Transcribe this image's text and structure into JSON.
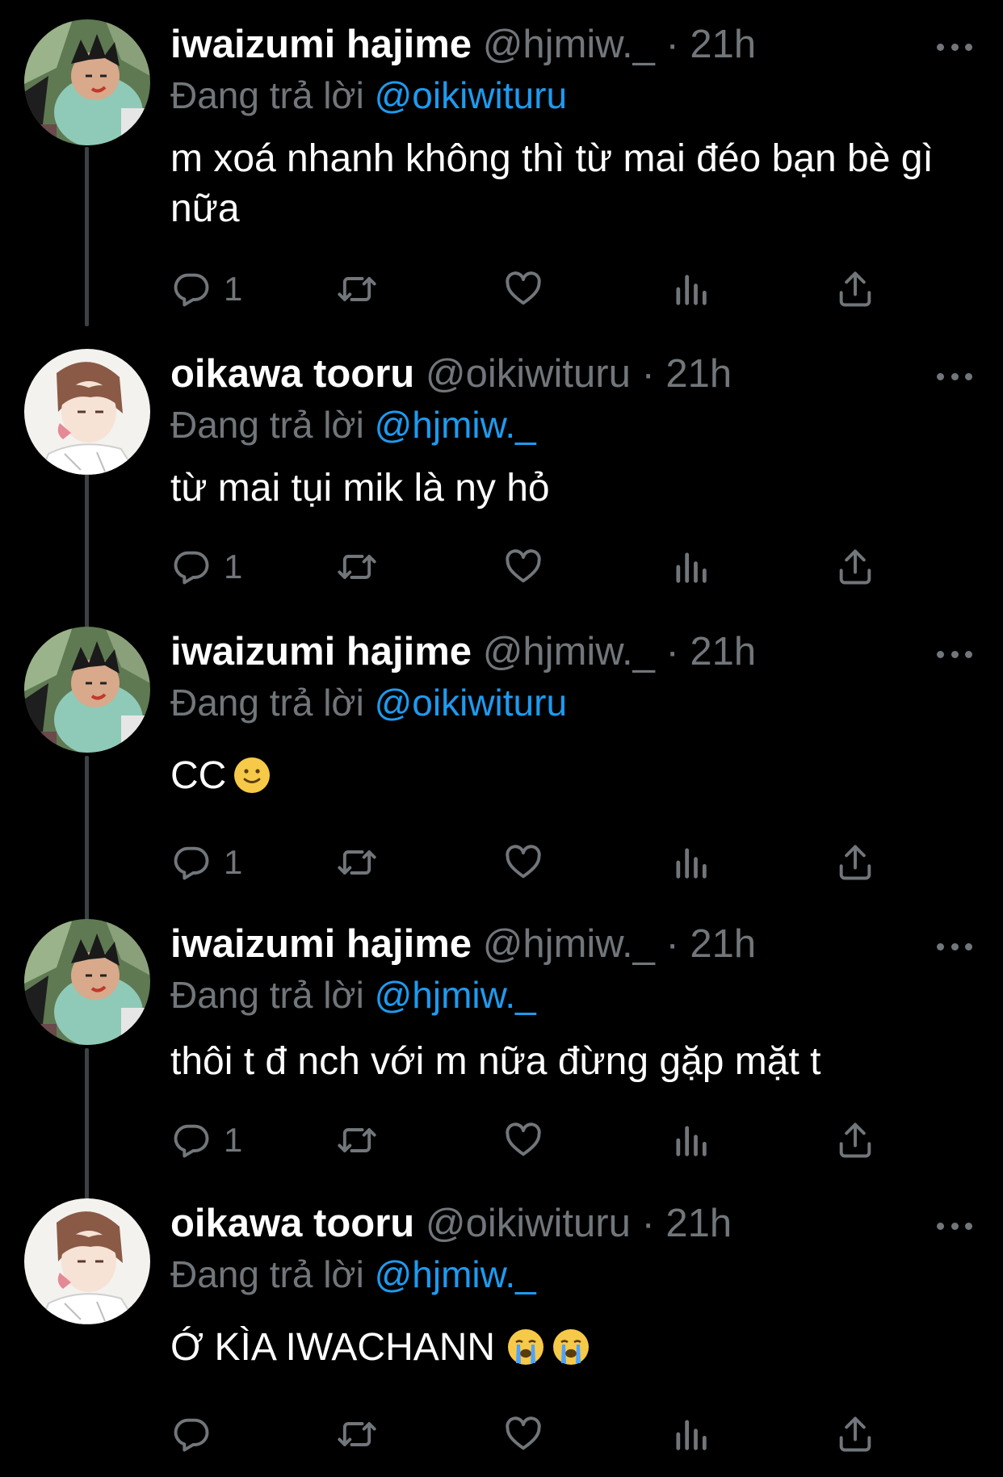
{
  "colors": {
    "background": "#000000",
    "name": "#ffffff",
    "muted": "#71767b",
    "link": "#1d9bf0",
    "connector": "#3e4144"
  },
  "tweets": [
    {
      "name": "iwaizumi hajime",
      "handle": "@hjmiw._",
      "separator": "·",
      "time": "21h",
      "reply_prefix": "Đang trả lời",
      "reply_to": "@oikiwituru",
      "text": "m xoá nhanh không thì từ mai đéo bạn bè gì nữa",
      "reply_count": "1",
      "avatar": "iwaizumi-avatar"
    },
    {
      "name": "oikawa tooru",
      "handle": "@oikiwituru",
      "separator": "·",
      "time": "21h",
      "reply_prefix": "Đang trả lời",
      "reply_to": "@hjmiw._",
      "text": "từ mai tụi mik là ny hỏ",
      "reply_count": "1",
      "avatar": "oikawa-avatar"
    },
    {
      "name": "iwaizumi hajime",
      "handle": "@hjmiw._",
      "separator": "·",
      "time": "21h",
      "reply_prefix": "Đang trả lời",
      "reply_to": "@oikiwituru",
      "text": "CC",
      "emojis": [
        "slightly-smiling-face"
      ],
      "reply_count": "1",
      "avatar": "iwaizumi-avatar"
    },
    {
      "name": "iwaizumi hajime",
      "handle": "@hjmiw._",
      "separator": "·",
      "time": "21h",
      "reply_prefix": "Đang trả lời",
      "reply_to": "@hjmiw._",
      "text": "thôi t đ nch với m nữa đừng gặp mặt t",
      "reply_count": "1",
      "avatar": "iwaizumi-avatar"
    },
    {
      "name": "oikawa tooru",
      "handle": "@oikiwituru",
      "separator": "·",
      "time": "21h",
      "reply_prefix": "Đang trả lời",
      "reply_to": "@hjmiw._",
      "text": "Ớ KÌA IWACHANN",
      "emojis": [
        "loudly-crying-face",
        "loudly-crying-face"
      ],
      "reply_count": "",
      "avatar": "oikawa-avatar"
    }
  ]
}
